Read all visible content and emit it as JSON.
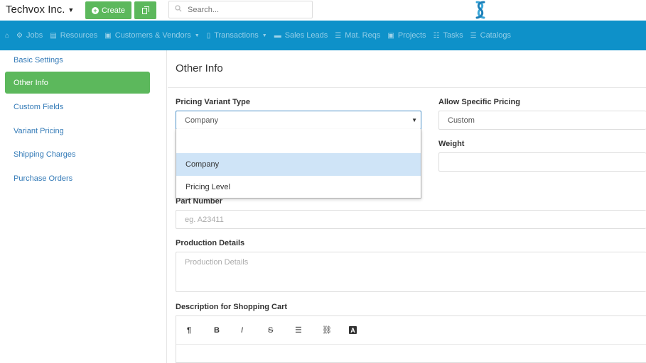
{
  "header": {
    "company": "Techvox Inc.",
    "create_label": "Create",
    "search_placeholder": "Search..."
  },
  "nav": {
    "items": [
      {
        "label": "Jobs",
        "icon": "cogs-icon",
        "dropdown": false
      },
      {
        "label": "Resources",
        "icon": "list-icon",
        "dropdown": false
      },
      {
        "label": "Customers & Vendors",
        "icon": "briefcase-icon",
        "dropdown": true
      },
      {
        "label": "Transactions",
        "icon": "file-icon",
        "dropdown": true
      },
      {
        "label": "Sales Leads",
        "icon": "inbox-icon",
        "dropdown": false
      },
      {
        "label": "Mat. Reqs",
        "icon": "list-icon",
        "dropdown": false
      },
      {
        "label": "Projects",
        "icon": "briefcase-icon",
        "dropdown": false
      },
      {
        "label": "Tasks",
        "icon": "tasks-icon",
        "dropdown": false
      },
      {
        "label": "Catalogs",
        "icon": "list-icon",
        "dropdown": false
      }
    ]
  },
  "sidebar": {
    "items": [
      {
        "label": "Basic Settings",
        "active": false
      },
      {
        "label": "Other Info",
        "active": true
      },
      {
        "label": "Custom Fields",
        "active": false
      },
      {
        "label": "Variant Pricing",
        "active": false
      },
      {
        "label": "Shipping Charges",
        "active": false
      },
      {
        "label": "Purchase Orders",
        "active": false
      }
    ]
  },
  "main": {
    "title": "Other Info",
    "pricing_variant_type": {
      "label": "Pricing Variant Type",
      "value": "Company",
      "options": [
        "Company",
        "Pricing Level"
      ],
      "highlighted": "Company"
    },
    "allow_specific_pricing": {
      "label": "Allow Specific Pricing",
      "value": "Custom"
    },
    "weight": {
      "label": "Weight",
      "value": ""
    },
    "part_number": {
      "label": "Part Number",
      "placeholder": "eg. A23411"
    },
    "production_details": {
      "label": "Production Details",
      "placeholder": "Production Details"
    },
    "description": {
      "label": "Description for Shopping Cart",
      "tools": [
        {
          "glyph": "¶",
          "name": "paragraph-icon"
        },
        {
          "glyph": "B",
          "name": "bold-icon"
        },
        {
          "glyph": "I",
          "name": "italic-icon"
        },
        {
          "glyph": "S",
          "name": "strikethrough-icon"
        },
        {
          "glyph": "☰",
          "name": "list-icon"
        },
        {
          "glyph": "⛓",
          "name": "link-icon"
        },
        {
          "glyph": "A",
          "name": "text-color-icon"
        }
      ]
    }
  },
  "colors": {
    "navbar": "#0e91c9",
    "green": "#5cb85c",
    "link": "#337ab7",
    "highlight": "#cfe4f7"
  }
}
